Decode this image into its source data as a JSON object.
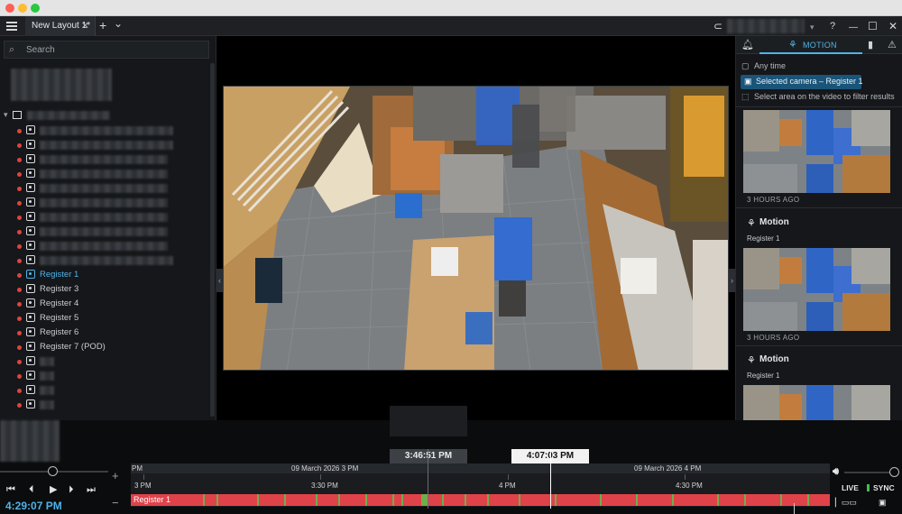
{
  "colors": {
    "accent": "#4fb3e8",
    "track_red": "#e0424a",
    "motion_tick": "#6fae4a",
    "status_dot": "#e0443c"
  },
  "header": {
    "tab_label": "New Layout 1*",
    "tab_close": "✕",
    "add_tab": "+",
    "tab_menu": "⌄",
    "help": "?",
    "minimize": "—",
    "maximize": "☐",
    "close": "✕",
    "dropdown": "▾"
  },
  "search": {
    "placeholder": "Search",
    "icon": "search-icon"
  },
  "cameras": [
    {
      "label": "Register 1",
      "active": true
    },
    {
      "label": "Register 3"
    },
    {
      "label": "Register 4"
    },
    {
      "label": "Register 5"
    },
    {
      "label": "Register 6"
    },
    {
      "label": "Register 7 (POD)"
    }
  ],
  "right_panel": {
    "tab_motion": "MOTION",
    "filter_any_time": "Any time",
    "filter_selected_camera": "Selected camera – Register 1",
    "filter_area": "Select area on the video to filter results",
    "events": [
      {
        "time_ago": "3 HOURS AGO",
        "title": "Motion",
        "camera": "Register 1"
      },
      {
        "time_ago": "3 HOURS AGO",
        "title": "Motion",
        "camera": "Register 1"
      }
    ]
  },
  "playback": {
    "current_time": "4:29:07 PM",
    "hover_time": "3:46:51 PM",
    "cursor_time": "4:07:03 PM",
    "live_label": "LIVE",
    "sync_label": "SYNC",
    "add": "+",
    "remove": "−"
  },
  "timeline": {
    "labels": [
      {
        "text": "PM",
        "row": "header"
      },
      {
        "text": "09 March 2026 3 PM",
        "row": "header"
      },
      {
        "text": "09 March 2026 4 PM",
        "row": "header"
      },
      {
        "text": "3 PM",
        "row": "ticks"
      },
      {
        "text": "3:30 PM",
        "row": "ticks"
      },
      {
        "text": "4 PM",
        "row": "ticks"
      },
      {
        "text": "4:30 PM",
        "row": "ticks"
      }
    ],
    "track_label": "Register 1"
  }
}
